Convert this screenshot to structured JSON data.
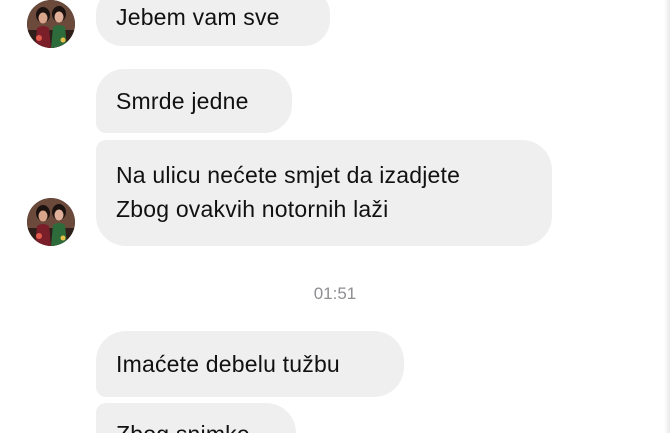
{
  "conversation": {
    "timestamp": "01:51",
    "messages": [
      {
        "text": "Jebem vam sve"
      },
      {
        "text": "Smrde jedne"
      },
      {
        "lines": [
          "Na ulicu nećete smjet da izadjete",
          "Zbog ovakvih notornih laži"
        ]
      },
      {
        "text": "Imaćete debelu tužbu"
      },
      {
        "text": "Zbog snimke"
      }
    ]
  },
  "colors": {
    "incoming_bubble": "#efeff0",
    "text": "#111111",
    "timestamp": "#8e8e93"
  },
  "icons": {
    "avatar": "contact-avatar-photo"
  }
}
